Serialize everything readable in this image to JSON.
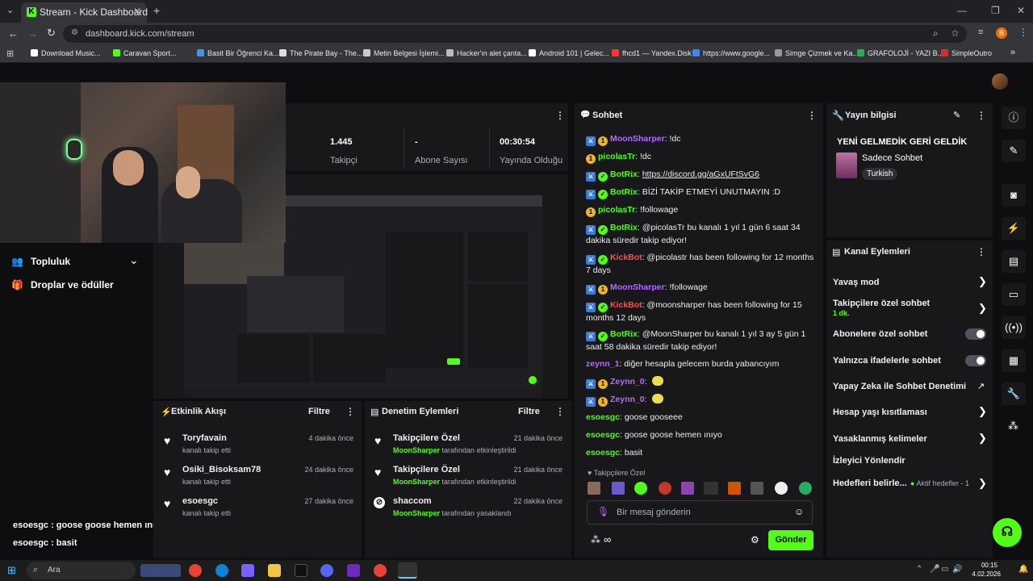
{
  "browser": {
    "tab_title": "Stream - Kick Dashboard",
    "url": "dashboard.kick.com/stream",
    "bookmarks": [
      "Download Music...",
      "Caravan Sport...",
      "Basit Bir Öğrenci Ka...",
      "The Pirate Bay - The...",
      "Metin Belgesi İşlemi...",
      "Hacker'ın alet çanta...",
      "Android 101 | Gelec...",
      "fhcd1 — Yandex.Disk",
      "https://www.google...",
      "Simge Çizmek ve Ka...",
      "GRAFOLOJİ - YAZI B...",
      "SimpleOutro"
    ]
  },
  "stats": [
    {
      "value": "1.445",
      "label": "Takipçi"
    },
    {
      "value": "-",
      "label": "Abone Sayısı"
    },
    {
      "value": "00:30:54",
      "label": "Yayında Olduğu"
    }
  ],
  "left_nav": {
    "community": "Topluluk",
    "drops": "Droplar ve ödüller"
  },
  "overlay_chat": [
    "esoesgc : goose goose hemen ınıyo",
    "esoesgc : basit"
  ],
  "activity": {
    "title": "Etkinlik Akışı",
    "filter": "Filtre",
    "items": [
      {
        "name": "Toryfavain",
        "sub": "kanalı takip etti",
        "time": "4 dakika önce"
      },
      {
        "name": "Osiki_Bisoksam78",
        "sub": "kanalı takip etti",
        "time": "24 dakika önce"
      },
      {
        "name": "esoesgc",
        "sub": "kanalı takip etti",
        "time": "27 dakika önce"
      }
    ]
  },
  "moderation": {
    "title": "Denetim Eylemleri",
    "filter": "Filtre",
    "items": [
      {
        "title": "Takipçilere Özel",
        "actor": "MoonSharper",
        "action": "tarafından etkinleştirildi",
        "time": "21 dakika önce"
      },
      {
        "title": "Takipçilere Özel",
        "actor": "MoonSharper",
        "action": "tarafından etkinleştirildi",
        "time": "21 dakika önce"
      },
      {
        "title": "shaccom",
        "actor": "MoonSharper",
        "action": "tarafından yasaklandı",
        "time": "22 dakika önce"
      }
    ]
  },
  "chat": {
    "title": "Sohbet",
    "messages": [
      {
        "user": "MoonSharper",
        "text": "!dc"
      },
      {
        "user": "picolasTr",
        "text": "!dc"
      },
      {
        "user": "BotRix",
        "text": "https://discord.gg/aGxUFtSvG6"
      },
      {
        "user": "BotRix",
        "text": "BİZİ TAKİP ETMEYİ UNUTMAYIN :D"
      },
      {
        "user": "picolasTr",
        "text": "!followage"
      },
      {
        "user": "BotRix",
        "text": "@picolasTr bu kanalı 1 yıl 1 gün 6 saat 34 dakika süredir takip ediyor!"
      },
      {
        "user": "KickBot",
        "text": "@picolastr has been following for 12 months 7 days"
      },
      {
        "user": "MoonSharper",
        "text": "!followage"
      },
      {
        "user": "KickBot",
        "text": "@moonsharper has been following for 15 months 12 days"
      },
      {
        "user": "BotRix",
        "text": "@MoonSharper bu kanalı 1 yıl 3 ay 5 gün 1 saat 58 dakika süredir takip ediyor!"
      },
      {
        "user": "zeynn_1",
        "text": "diğer hesapla gelecem burda yabancıyım"
      },
      {
        "user": "Zeynn_0",
        "text": ""
      },
      {
        "user": "Zeynn_0",
        "text": ""
      },
      {
        "user": "esoesgc",
        "text": "goose gooseee"
      },
      {
        "user": "esoesgc",
        "text": "goose goose hemen ınıyo"
      },
      {
        "user": "esoesgc",
        "text": "basit"
      }
    ],
    "mode_label": "Takipçilere Özel",
    "input_placeholder": "Bir mesaj gönderin",
    "send": "Gönder"
  },
  "stream_info": {
    "title": "Yayın bilgisi",
    "stream_title": "YENİ GELMEDİK GERİ GELDİK",
    "category": "Sadece Sohbet",
    "language": "Turkish"
  },
  "channel_actions": {
    "title": "Kanal Eylemleri",
    "slow_mode": "Yavaş mod",
    "followers_only": "Takipçilere özel sohbet",
    "followers_only_value": "1 dk.",
    "subscribers_only": "Abonelere özel sohbet",
    "emotes_only": "Yalnızca ifadelerle sohbet",
    "ai_moderation": "Yapay Zeka ile Sohbet Denetimi",
    "account_age": "Hesap yaşı kısıtlaması",
    "banned_words": "Yasaklanmış kelimeler",
    "redirect": "İzleyici Yönlendir",
    "goals": "Hedefleri belirle...",
    "goals_status": "Aktif hedefler - 1"
  },
  "taskbar": {
    "search": "Ara",
    "time": "00:15",
    "date": "4.02.2026"
  },
  "colors": {
    "kick_green": "#53fc18",
    "purple": "#b36bff",
    "red": "#ff4d4d",
    "mod_blue": "#3a7bd5"
  }
}
